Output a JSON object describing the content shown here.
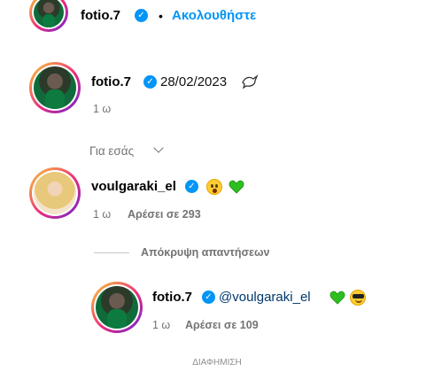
{
  "post_header": {
    "username": "fotio.7",
    "follow_label": "Ακολουθήστε",
    "separator": "•"
  },
  "caption": {
    "username": "fotio.7",
    "text": "28/02/2023",
    "time": "1 ω",
    "emoji": "dove"
  },
  "for_you": {
    "label": "Για εσάς"
  },
  "comment": {
    "username": "voulgaraki_el",
    "time": "1 ω",
    "likes": "Αρέσει σε 293",
    "emojis": [
      "hushed-face",
      "green-heart"
    ]
  },
  "hide_replies": {
    "label": "Απόκρυψη απαντήσεων"
  },
  "reply": {
    "username": "fotio.7",
    "mention": "@voulgaraki_el",
    "time": "1 ω",
    "likes": "Αρέσει σε 109",
    "emojis": [
      "green-heart",
      "smiling-face-with-sunglasses"
    ]
  },
  "ad_label": "ΔΙΑΦΗΜΙΣΗ",
  "colors": {
    "accent": "#0095f6",
    "muted": "#737373",
    "green_heart": "#2dbf1f"
  }
}
